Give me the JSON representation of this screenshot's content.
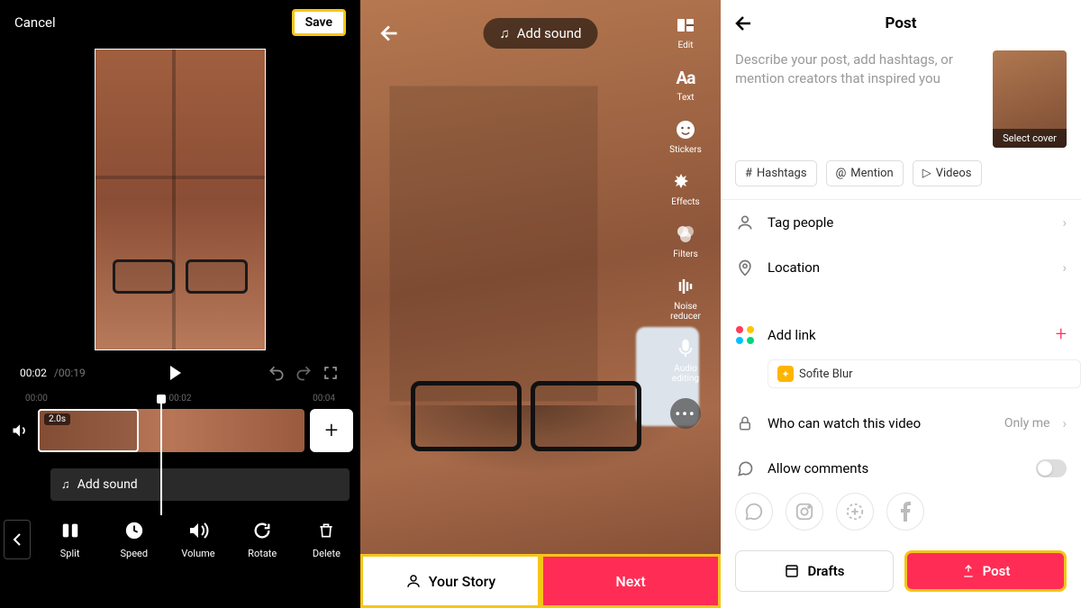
{
  "panel1": {
    "cancel": "Cancel",
    "save": "Save",
    "time_current": "00:02",
    "time_total": "/00:19",
    "ticks": [
      "00:00",
      "00:02",
      "00:04"
    ],
    "clip_duration": "2.0s",
    "add_sound": "Add sound",
    "tools": {
      "split": "Split",
      "speed": "Speed",
      "volume": "Volume",
      "rotate": "Rotate",
      "delete": "Delete"
    }
  },
  "panel2": {
    "add_sound": "Add sound",
    "tools": {
      "edit": "Edit",
      "text": "Text",
      "stickers": "Stickers",
      "effects": "Effects",
      "filters": "Filters",
      "noise": "Noise reducer",
      "audio": "Audio editing"
    },
    "story": "Your Story",
    "next": "Next"
  },
  "panel3": {
    "title": "Post",
    "description_placeholder": "Describe your post, add hashtags, or mention creators that inspired you",
    "select_cover": "Select cover",
    "chips": {
      "hashtags": "Hashtags",
      "mention": "Mention",
      "videos": "Videos"
    },
    "tag_people": "Tag people",
    "location": "Location",
    "add_link": "Add link",
    "link_chip": "Sofite Blur",
    "privacy_label": "Who can watch this video",
    "privacy_value": "Only me",
    "comments": "Allow comments",
    "drafts": "Drafts",
    "post": "Post"
  }
}
